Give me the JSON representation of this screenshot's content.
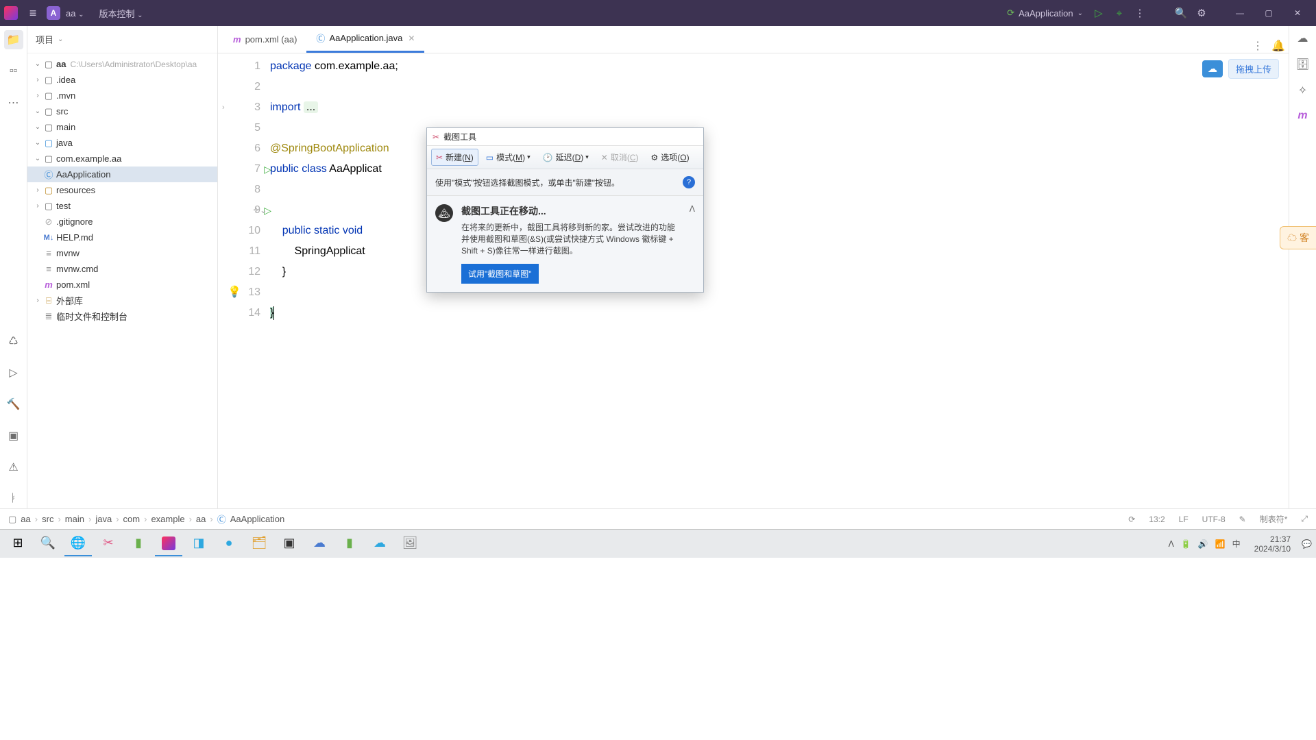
{
  "titlebar": {
    "project_badge": "A",
    "project_name": "aa",
    "vcs": "版本控制",
    "run_config": "AaApplication"
  },
  "left_rail": {
    "items": [
      "folder",
      "grid",
      "more"
    ]
  },
  "project_panel": {
    "title": "项目",
    "root_name": "aa",
    "root_path": "C:\\Users\\Administrator\\Desktop\\aa",
    "nodes": {
      "idea": ".idea",
      "mvn": ".mvn",
      "src": "src",
      "main": "main",
      "java": "java",
      "pkg": "com.example.aa",
      "cls": "AaApplication",
      "resources": "resources",
      "test": "test",
      "gitignore": ".gitignore",
      "help": "HELP.md",
      "mvnw": "mvnw",
      "mvnwcmd": "mvnw.cmd",
      "pom": "pom.xml",
      "extlib": "外部库",
      "scratch": "临时文件和控制台"
    }
  },
  "tabs": {
    "pom": "pom.xml (aa)",
    "app": "AaApplication.java"
  },
  "upload": {
    "label": "拖拽上传"
  },
  "code": {
    "lines": {
      "1": "package com.example.aa;",
      "3_pre": "import ",
      "3_dots": "...",
      "6": "@SpringBootApplication",
      "7": "public class AaApplicat",
      "9": "    public static void",
      "10": "        SpringApplicat",
      "11": "    }",
      "13": "}"
    },
    "line_numbers": [
      "1",
      "2",
      "3",
      "5",
      "6",
      "7",
      "8",
      "9",
      "10",
      "11",
      "12",
      "13",
      "14"
    ]
  },
  "breadcrumb": {
    "parts": [
      "aa",
      "src",
      "main",
      "java",
      "com",
      "example",
      "aa",
      "AaApplication"
    ],
    "status": {
      "pos": "13:2",
      "eol": "LF",
      "enc": "UTF-8",
      "indent": "制表符*"
    }
  },
  "snip": {
    "title": "截图工具",
    "new": "新建(N)",
    "mode": "模式(M)",
    "delay": "延迟(D)",
    "cancel": "取消(C)",
    "options": "选项(O)",
    "hint": "使用\"模式\"按钮选择截图模式，或单击\"新建\"按钮。",
    "notice_title": "截图工具正在移动...",
    "notice_msg": "在将来的更新中，截图工具将移到新的家。尝试改进的功能并使用截图和草图(&S)(或尝试快捷方式 Windows 徽标键 + Shift + S)像往常一样进行截图。",
    "try": "试用\"截图和草图\""
  },
  "orange_tab": "客",
  "taskbar": {
    "time": "21:37",
    "date": "2024/3/10",
    "ime": "中"
  }
}
